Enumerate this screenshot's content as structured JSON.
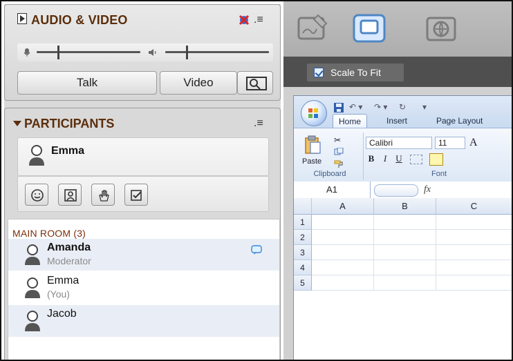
{
  "audio_video": {
    "title": "AUDIO & VIDEO",
    "talk_label": "Talk",
    "video_label": "Video",
    "mic_icon": "microphone-icon",
    "speaker_icon": "speaker-icon",
    "settings_icon": "av-settings-icon",
    "menu_icon": "menu-icon",
    "camera_preview_icon": "camera-preview-icon",
    "mic_level": 0.2,
    "speaker_level": 0.2
  },
  "participants": {
    "title": "PARTICIPANTS",
    "menu_icon": "menu-icon",
    "me": {
      "name": "Emma"
    },
    "tools": [
      "emoticon-icon",
      "profile-icon",
      "raise-hand-icon",
      "checkbox-status-icon"
    ],
    "room_label": "MAIN ROOM (3)",
    "list": [
      {
        "name": "Amanda",
        "role": "Moderator",
        "icon": "chat-icon"
      },
      {
        "name": "Emma",
        "role": "(You)"
      },
      {
        "name": "Jacob",
        "role": ""
      }
    ]
  },
  "share": {
    "scale_label": "Scale To Fit",
    "scale_checked": true,
    "excel": {
      "tabs": [
        "Home",
        "Insert",
        "Page Layout"
      ],
      "active_tab": "Home",
      "paste_label": "Paste",
      "clipboard_label": "Clipboard",
      "font_label": "Font",
      "font_name": "Calibri",
      "font_size": "11",
      "namebox": "A1",
      "fx": "fx",
      "columns": [
        "A",
        "B",
        "C"
      ],
      "rows": [
        "1",
        "2",
        "3",
        "4",
        "5"
      ]
    }
  },
  "colors": {
    "header_text": "#5b2e0c",
    "room_label": "#7a2f0a",
    "panel_bg": "#d9d9d9",
    "right_bg": "#d0d0d0",
    "scale_bar": "#4f4f4f",
    "excel_accent": "#9db4d8"
  }
}
